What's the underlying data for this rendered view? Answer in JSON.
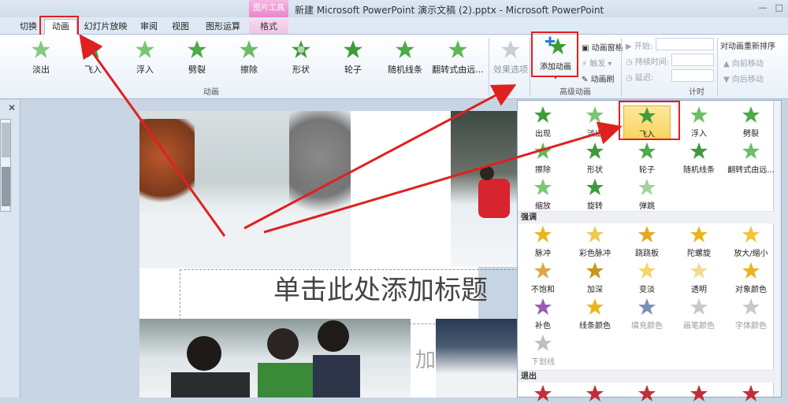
{
  "window": {
    "context_group": "图片工具",
    "title": "新建 Microsoft PowerPoint 演示文稿 (2).pptx  -  Microsoft PowerPoint",
    "minimize": "—",
    "maximize": "□"
  },
  "tabs": [
    {
      "label": "切换"
    },
    {
      "label": "动画"
    },
    {
      "label": "幻灯片放映"
    },
    {
      "label": "审阅"
    },
    {
      "label": "视图"
    },
    {
      "label": "图形运算"
    },
    {
      "label": "格式"
    }
  ],
  "ribbon": {
    "effects": [
      "淡出",
      "飞入",
      "浮入",
      "劈裂",
      "擦除",
      "形状",
      "轮子",
      "随机线条",
      "翻转式由远..."
    ],
    "effect_options": "效果选项",
    "group_animation": "动画",
    "add_animation": "添加动画",
    "animation_pane": "动画窗格",
    "trigger": "触发",
    "animation_painter": "动画刷",
    "group_advanced": "高级动画",
    "start_label": "开始:",
    "duration_label": "持续时间:",
    "delay_label": "延迟:",
    "group_timing": "计时",
    "reorder_title": "对动画重新排序",
    "move_earlier": "向前移动",
    "move_later": "向后移动"
  },
  "slide": {
    "title": "单击此处添加标题",
    "subtitle": "加"
  },
  "gallery": {
    "entrance": [
      "出现",
      "淡出",
      "飞入",
      "浮入",
      "劈裂",
      "擦除",
      "形状",
      "轮子",
      "随机线条",
      "翻转式由远...",
      "缩放",
      "旋转",
      "弹跳"
    ],
    "emphasis_header": "强调",
    "emphasis": [
      "脉冲",
      "彩色脉冲",
      "跷跷板",
      "陀螺旋",
      "放大/缩小",
      "不饱和",
      "加深",
      "变淡",
      "透明",
      "对象颜色",
      "补色",
      "线条颜色",
      "填充颜色",
      "画笔颜色",
      "字体颜色",
      "下划线"
    ],
    "exit_header": "退出"
  },
  "colors": {
    "entrance_green": "#3f9b3a",
    "emphasis_gold": "#e9b51e",
    "exit_red": "#c0303a",
    "highlight_box": "#e02020",
    "selected_fill": "#f9d45e"
  }
}
